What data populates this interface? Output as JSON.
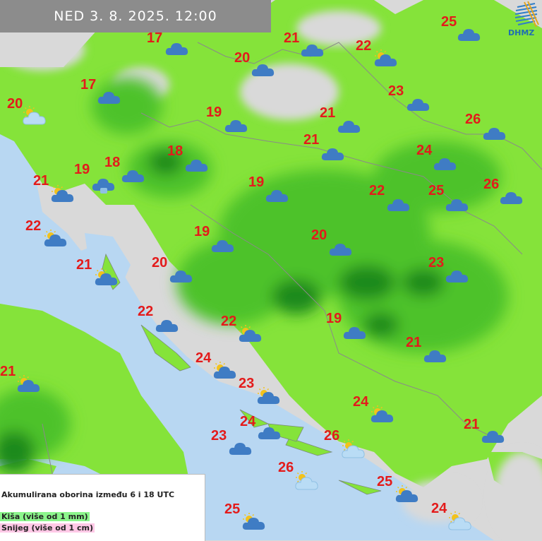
{
  "header": {
    "date_time": "NED  3. 8. 2025. 12:00"
  },
  "logo": {
    "text": "DHMZ"
  },
  "legend": {
    "title": "Akumulirana oborina između 6 i 18 UTC",
    "rain": "Kiša (više od 1 mm)",
    "snow": "Snijeg (više od 1 cm)",
    "rain_color": "#8cf58c",
    "snow_color": "#ffc8e6"
  },
  "colors": {
    "sea": "#b8d7f2",
    "land": "#d9d9d9",
    "rain_light": "#85e33a",
    "rain_mid": "#4dc22a",
    "rain_dark": "#1f8a1c",
    "temperature": "#e31b1b",
    "cloud": "#3f7cc4"
  },
  "stations": [
    {
      "temp": "17",
      "icon": "cloud-icon"
    },
    {
      "temp": "21",
      "icon": "cloud-icon"
    },
    {
      "temp": "22",
      "icon": "sun-cloud-icon"
    },
    {
      "temp": "25",
      "icon": "cloud-icon"
    },
    {
      "temp": "20",
      "icon": "cloud-icon"
    },
    {
      "temp": "17",
      "icon": "cloud-icon"
    },
    {
      "temp": "20",
      "icon": "sun-cloud-fog-icon"
    },
    {
      "temp": "23",
      "icon": "cloud-icon"
    },
    {
      "temp": "19",
      "icon": "cloud-icon"
    },
    {
      "temp": "21",
      "icon": "cloud-icon"
    },
    {
      "temp": "26",
      "icon": "cloud-icon"
    },
    {
      "temp": "21",
      "icon": "cloud-icon"
    },
    {
      "temp": "18",
      "icon": "cloud-icon"
    },
    {
      "temp": "24",
      "icon": "cloud-icon"
    },
    {
      "temp": "19",
      "icon": "cloud-rain-icon"
    },
    {
      "temp": "18",
      "icon": "cloud-icon"
    },
    {
      "temp": "21",
      "icon": "sun-cloud-icon"
    },
    {
      "temp": "19",
      "icon": "cloud-icon"
    },
    {
      "temp": "22",
      "icon": "cloud-icon"
    },
    {
      "temp": "25",
      "icon": "cloud-icon"
    },
    {
      "temp": "26",
      "icon": "cloud-icon"
    },
    {
      "temp": "22",
      "icon": "sun-cloud-icon"
    },
    {
      "temp": "19",
      "icon": "cloud-icon"
    },
    {
      "temp": "20",
      "icon": "cloud-icon"
    },
    {
      "temp": "21",
      "icon": "sun-cloud-icon"
    },
    {
      "temp": "20",
      "icon": "cloud-icon"
    },
    {
      "temp": "23",
      "icon": "cloud-icon"
    },
    {
      "temp": "22",
      "icon": "cloud-icon"
    },
    {
      "temp": "22",
      "icon": "sun-cloud-icon"
    },
    {
      "temp": "19",
      "icon": "cloud-icon"
    },
    {
      "temp": "21",
      "icon": "cloud-icon"
    },
    {
      "temp": "24",
      "icon": "sun-cloud-icon"
    },
    {
      "temp": "21",
      "icon": "sun-cloud-icon"
    },
    {
      "temp": "23",
      "icon": "sun-cloud-icon"
    },
    {
      "temp": "24",
      "icon": "sun-cloud-icon"
    },
    {
      "temp": "24",
      "icon": "cloud-icon"
    },
    {
      "temp": "23",
      "icon": "cloud-icon"
    },
    {
      "temp": "26",
      "icon": "sun-cloud-fog-icon"
    },
    {
      "temp": "21",
      "icon": "cloud-icon"
    },
    {
      "temp": "26",
      "icon": "sun-cloud-fog-icon"
    },
    {
      "temp": "25",
      "icon": "sun-cloud-icon"
    },
    {
      "temp": "25",
      "icon": "sun-cloud-icon"
    },
    {
      "temp": "24",
      "icon": "sun-cloud-fog-icon"
    }
  ]
}
